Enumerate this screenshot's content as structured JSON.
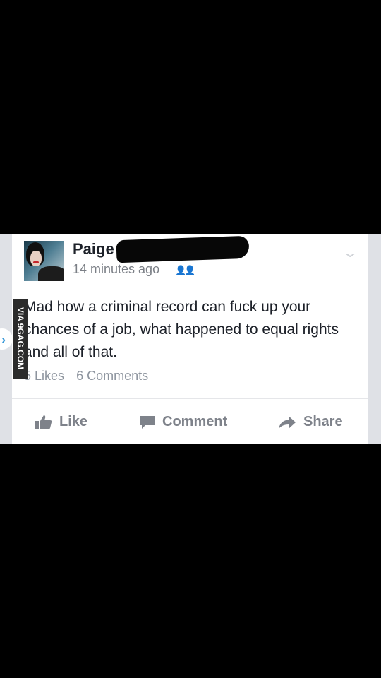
{
  "post": {
    "author_name": "Paige",
    "timestamp": "14 minutes ago",
    "privacy_icon": "friends-icon",
    "text": "Mad how a criminal record can fuck up your chances of a job, what happened to equal rights and all of that.",
    "likes": "5 Likes",
    "comments": "6 Comments"
  },
  "actions": {
    "like_label": "Like",
    "comment_label": "Comment",
    "share_label": "Share"
  },
  "watermark": {
    "text": "VIA 9GAG.COM"
  },
  "colors": {
    "background": "#000000",
    "card": "#ffffff",
    "text": "#1d2129",
    "secondary_text": "#8d949e"
  }
}
